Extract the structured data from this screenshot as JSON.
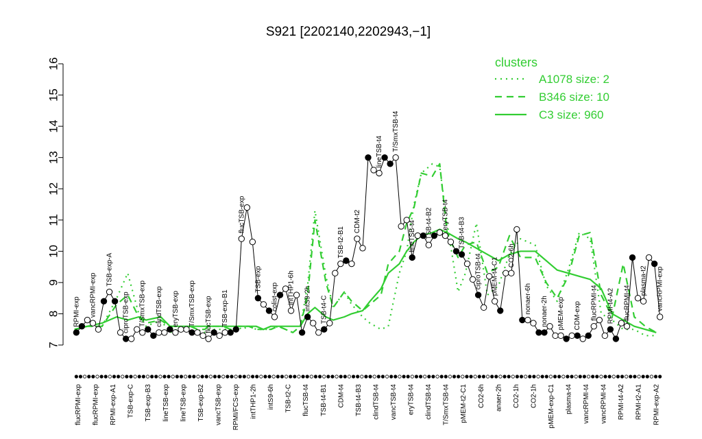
{
  "chart_data": {
    "type": "line",
    "title": "S921 [2202140,2202943,−1]",
    "xlabel": "",
    "ylabel": "",
    "ylim": [
      7,
      16
    ],
    "yticks": [
      7,
      8,
      9,
      10,
      11,
      12,
      13,
      14,
      15,
      16
    ],
    "grid": false,
    "legend_placement": "top-right",
    "colors": {
      "clusters": "#32cd32",
      "points": "#000000"
    },
    "legend": {
      "title": "clusters",
      "entries": [
        {
          "label": "A1078 size: 2",
          "style": "dotted"
        },
        {
          "label": "B346 size: 10",
          "style": "dashed"
        },
        {
          "label": "C3 size: 960",
          "style": "solid"
        }
      ]
    },
    "x_tick_labels": [
      "flucRPMI-exp",
      "flucRPMI-exp",
      "RPMI-exp-A1",
      "TSB-exp-C",
      "TSB-exp-B3",
      "lineTSB-exp",
      "lineTSB-exp",
      "TSB-exp-B2",
      "vancTSB-exp",
      "RPMI/FCS-exp",
      "intTHP1-2h",
      "intS9-6h",
      "TSB-t2-C",
      "flucTSB-t4",
      "TSB-t4-B1",
      "CDM-t4",
      "TSB-t4-B3",
      "clindTSB-t4",
      "vancTSB-t4",
      "eryTSB-t4",
      "clindTSB-t4",
      "T/SmxTSB-t4",
      "pMEM-t2-C1",
      "CO2-6h",
      "anaer-2h",
      "CO2-1h",
      "CO2-1h",
      "pMEM-exp-C1",
      "plasma-t4",
      "vancRPMI-t4",
      "vancRPMI-t4",
      "RPMI-t4-A2",
      "RPMI-t2-A1",
      "RPMI-exp-A2"
    ],
    "point_labels": [
      "RPMI-exp",
      "vancRPMI-exp",
      "TSB-exp-A",
      "ciproTSB-exp",
      "T/SmxTSB-exp",
      "clindTSB-exp",
      "eryTSB-exp",
      "T/SmxTSB-exp",
      "flucTSB-exp",
      "TSB-exp-B1",
      "flucTSB-exp",
      "TSB-exp",
      "colist-exp",
      "intTHP1-6h",
      "intS9-2h",
      "TSB-t4-C",
      "TSB-t2-B1",
      "CDM-t2",
      "lineTSB-t4",
      "T/SmxTSB-t4",
      "lineTSB-t4",
      "TSB-t4-B2",
      "eryTSB-t4",
      "TSB-t4-B3",
      "ciproTSB-t4",
      "pMEM-t4-C1",
      "CO2-6h",
      "nonaer-6h",
      "nonaer-2h",
      "pMEM-exp",
      "CDM-exp",
      "flucRPMI-t4",
      "RPMI-t4-A2",
      "flucRPMI-t4",
      "plasma-t2",
      "vancRPMI-exp"
    ],
    "series": [
      {
        "name": "A1078 size: 2",
        "style": "dotted",
        "x": [
          1,
          8,
          16,
          24,
          30,
          36,
          40,
          48,
          53,
          57,
          60,
          64,
          68,
          72,
          74,
          78,
          82,
          86,
          90,
          92,
          96,
          100,
          104,
          108,
          112,
          116,
          120,
          124,
          128,
          132,
          138,
          142,
          148,
          152,
          158,
          162,
          168,
          172,
          178,
          182,
          186,
          190,
          196,
          200,
          204,
          210,
          214,
          220,
          226,
          232,
          238,
          244,
          252,
          258,
          264,
          270,
          276,
          282,
          288,
          294,
          300,
          306,
          312,
          318
        ],
        "y": [
          7.5,
          7.6,
          7.6,
          8.5,
          9.3,
          8.0,
          7.6,
          7.8,
          7.4,
          7.5,
          7.4,
          7.6,
          7.5,
          7.4,
          7.5,
          7.5,
          7.5,
          7.5,
          7.6,
          7.5,
          7.6,
          7.5,
          7.5,
          7.5,
          7.6,
          7.5,
          7.4,
          7.6,
          8.9,
          11.3,
          9.2,
          8.2,
          8.7,
          8.3,
          7.9,
          7.7,
          7.5,
          7.6,
          9.3,
          10.0,
          11.5,
          12.5,
          12.8,
          12.7,
          10.9,
          8.7,
          9.3,
          10.9,
          8.6,
          8.9,
          9.9,
          10.4,
          10.2,
          8.9,
          8.4,
          9.4,
          10.6,
          10.4,
          8.0,
          7.8,
          7.5,
          7.5,
          7.3,
          7.3
        ]
      },
      {
        "name": "B346 size: 10",
        "style": "dashed",
        "x": [
          1,
          8,
          16,
          24,
          30,
          36,
          40,
          48,
          53,
          57,
          60,
          64,
          68,
          72,
          74,
          78,
          82,
          86,
          90,
          92,
          96,
          100,
          104,
          108,
          112,
          116,
          120,
          124,
          128,
          132,
          138,
          142,
          148,
          152,
          158,
          162,
          168,
          172,
          178,
          182,
          186,
          190,
          196,
          200,
          204,
          210,
          214,
          220,
          226,
          232,
          238,
          244,
          252,
          258,
          264,
          270,
          276,
          282,
          288,
          294,
          300,
          306,
          312,
          318
        ],
        "y": [
          7.5,
          7.6,
          7.6,
          8.3,
          8.6,
          7.9,
          7.7,
          7.8,
          7.6,
          7.6,
          7.5,
          7.6,
          7.5,
          7.5,
          7.6,
          7.6,
          7.6,
          7.5,
          7.6,
          7.6,
          7.6,
          7.5,
          7.5,
          7.5,
          7.6,
          7.5,
          7.4,
          7.6,
          8.6,
          11.0,
          9.0,
          8.2,
          8.7,
          8.4,
          8.1,
          8.3,
          8.6,
          9.6,
          10.0,
          10.9,
          11.4,
          12.5,
          12.4,
          12.8,
          10.6,
          9.8,
          10.2,
          10.3,
          9.3,
          9.5,
          10.5,
          9.8,
          9.8,
          9.0,
          8.5,
          9.2,
          10.5,
          10.6,
          8.6,
          7.9,
          9.6,
          7.9,
          7.6,
          7.4
        ]
      },
      {
        "name": "C3 size: 960",
        "style": "solid",
        "x": [
          1,
          8,
          16,
          24,
          30,
          36,
          40,
          48,
          53,
          57,
          60,
          64,
          68,
          72,
          74,
          78,
          82,
          86,
          90,
          92,
          96,
          100,
          104,
          108,
          112,
          116,
          120,
          124,
          128,
          132,
          138,
          142,
          148,
          152,
          158,
          162,
          168,
          172,
          178,
          182,
          186,
          190,
          196,
          200,
          204,
          210,
          214,
          220,
          226,
          232,
          238,
          244,
          252,
          258,
          264,
          270,
          276,
          282,
          288,
          294,
          300,
          306,
          312,
          318
        ],
        "y": [
          7.5,
          7.6,
          7.7,
          7.9,
          7.8,
          7.9,
          7.8,
          7.9,
          7.6,
          7.6,
          7.6,
          7.6,
          7.6,
          7.6,
          7.6,
          7.6,
          7.6,
          7.6,
          7.6,
          7.6,
          7.6,
          7.6,
          7.5,
          7.6,
          7.6,
          7.6,
          7.6,
          7.6,
          8.0,
          8.2,
          7.9,
          7.8,
          7.9,
          8.0,
          8.1,
          8.4,
          8.8,
          9.3,
          9.6,
          10.0,
          10.3,
          10.5,
          10.6,
          10.7,
          10.6,
          10.4,
          10.3,
          10.1,
          9.9,
          9.7,
          9.9,
          10.0,
          10.0,
          9.7,
          9.4,
          9.3,
          9.2,
          9.1,
          8.8,
          8.0,
          7.8,
          7.6,
          7.5,
          7.4
        ]
      }
    ],
    "points": {
      "x": [
        2,
        5,
        8,
        11,
        14,
        17,
        20,
        23,
        26,
        29,
        32,
        35,
        38,
        41,
        44,
        47,
        50,
        53,
        56,
        59,
        62,
        65,
        68,
        71,
        74,
        77,
        80,
        83,
        86,
        89,
        92,
        95,
        98,
        101,
        104,
        107,
        110,
        113,
        116,
        119,
        122,
        125,
        128,
        131,
        134,
        137,
        140,
        143,
        146,
        149,
        152,
        155,
        158,
        161,
        164,
        167,
        170,
        173,
        176,
        179,
        182,
        185,
        188,
        191,
        194,
        197,
        200,
        203,
        206,
        209,
        212,
        215,
        218,
        221,
        224,
        227,
        230,
        233,
        236,
        239,
        242,
        245,
        248,
        251,
        254,
        257,
        260,
        263,
        266,
        269,
        272,
        275,
        278,
        281,
        284,
        287,
        290,
        293,
        296,
        299,
        302,
        305,
        308,
        311,
        314,
        317,
        320
      ],
      "y": [
        7.4,
        7.6,
        7.8,
        7.7,
        7.5,
        8.4,
        8.7,
        8.4,
        7.4,
        7.2,
        7.2,
        7.5,
        7.4,
        7.5,
        7.3,
        7.4,
        7.4,
        7.5,
        7.4,
        7.5,
        7.5,
        7.4,
        7.4,
        7.3,
        7.2,
        7.4,
        7.3,
        7.4,
        7.4,
        7.5,
        10.4,
        11.4,
        10.3,
        8.5,
        8.3,
        8.1,
        7.9,
        8.6,
        8.8,
        8.1,
        8.6,
        7.4,
        7.9,
        7.7,
        7.4,
        7.5,
        7.7,
        9.3,
        9.6,
        9.7,
        9.6,
        10.4,
        10.1,
        13.0,
        12.6,
        12.5,
        13.0,
        12.8,
        13.0,
        10.8,
        11.0,
        9.8,
        10.5,
        10.5,
        10.2,
        10.5,
        10.6,
        10.5,
        10.3,
        10.0,
        9.9,
        9.6,
        9.1,
        8.6,
        8.2,
        9.2,
        8.4,
        8.1,
        9.3,
        9.3,
        10.7,
        7.8,
        7.8,
        7.7,
        7.4,
        7.4,
        7.6,
        7.3,
        7.3,
        7.2,
        7.3,
        7.3,
        7.2,
        7.3,
        7.6,
        7.8,
        7.3,
        7.5,
        7.2,
        7.7,
        7.6,
        9.8,
        8.5,
        8.4,
        9.8,
        9.6,
        7.9
      ]
    }
  }
}
